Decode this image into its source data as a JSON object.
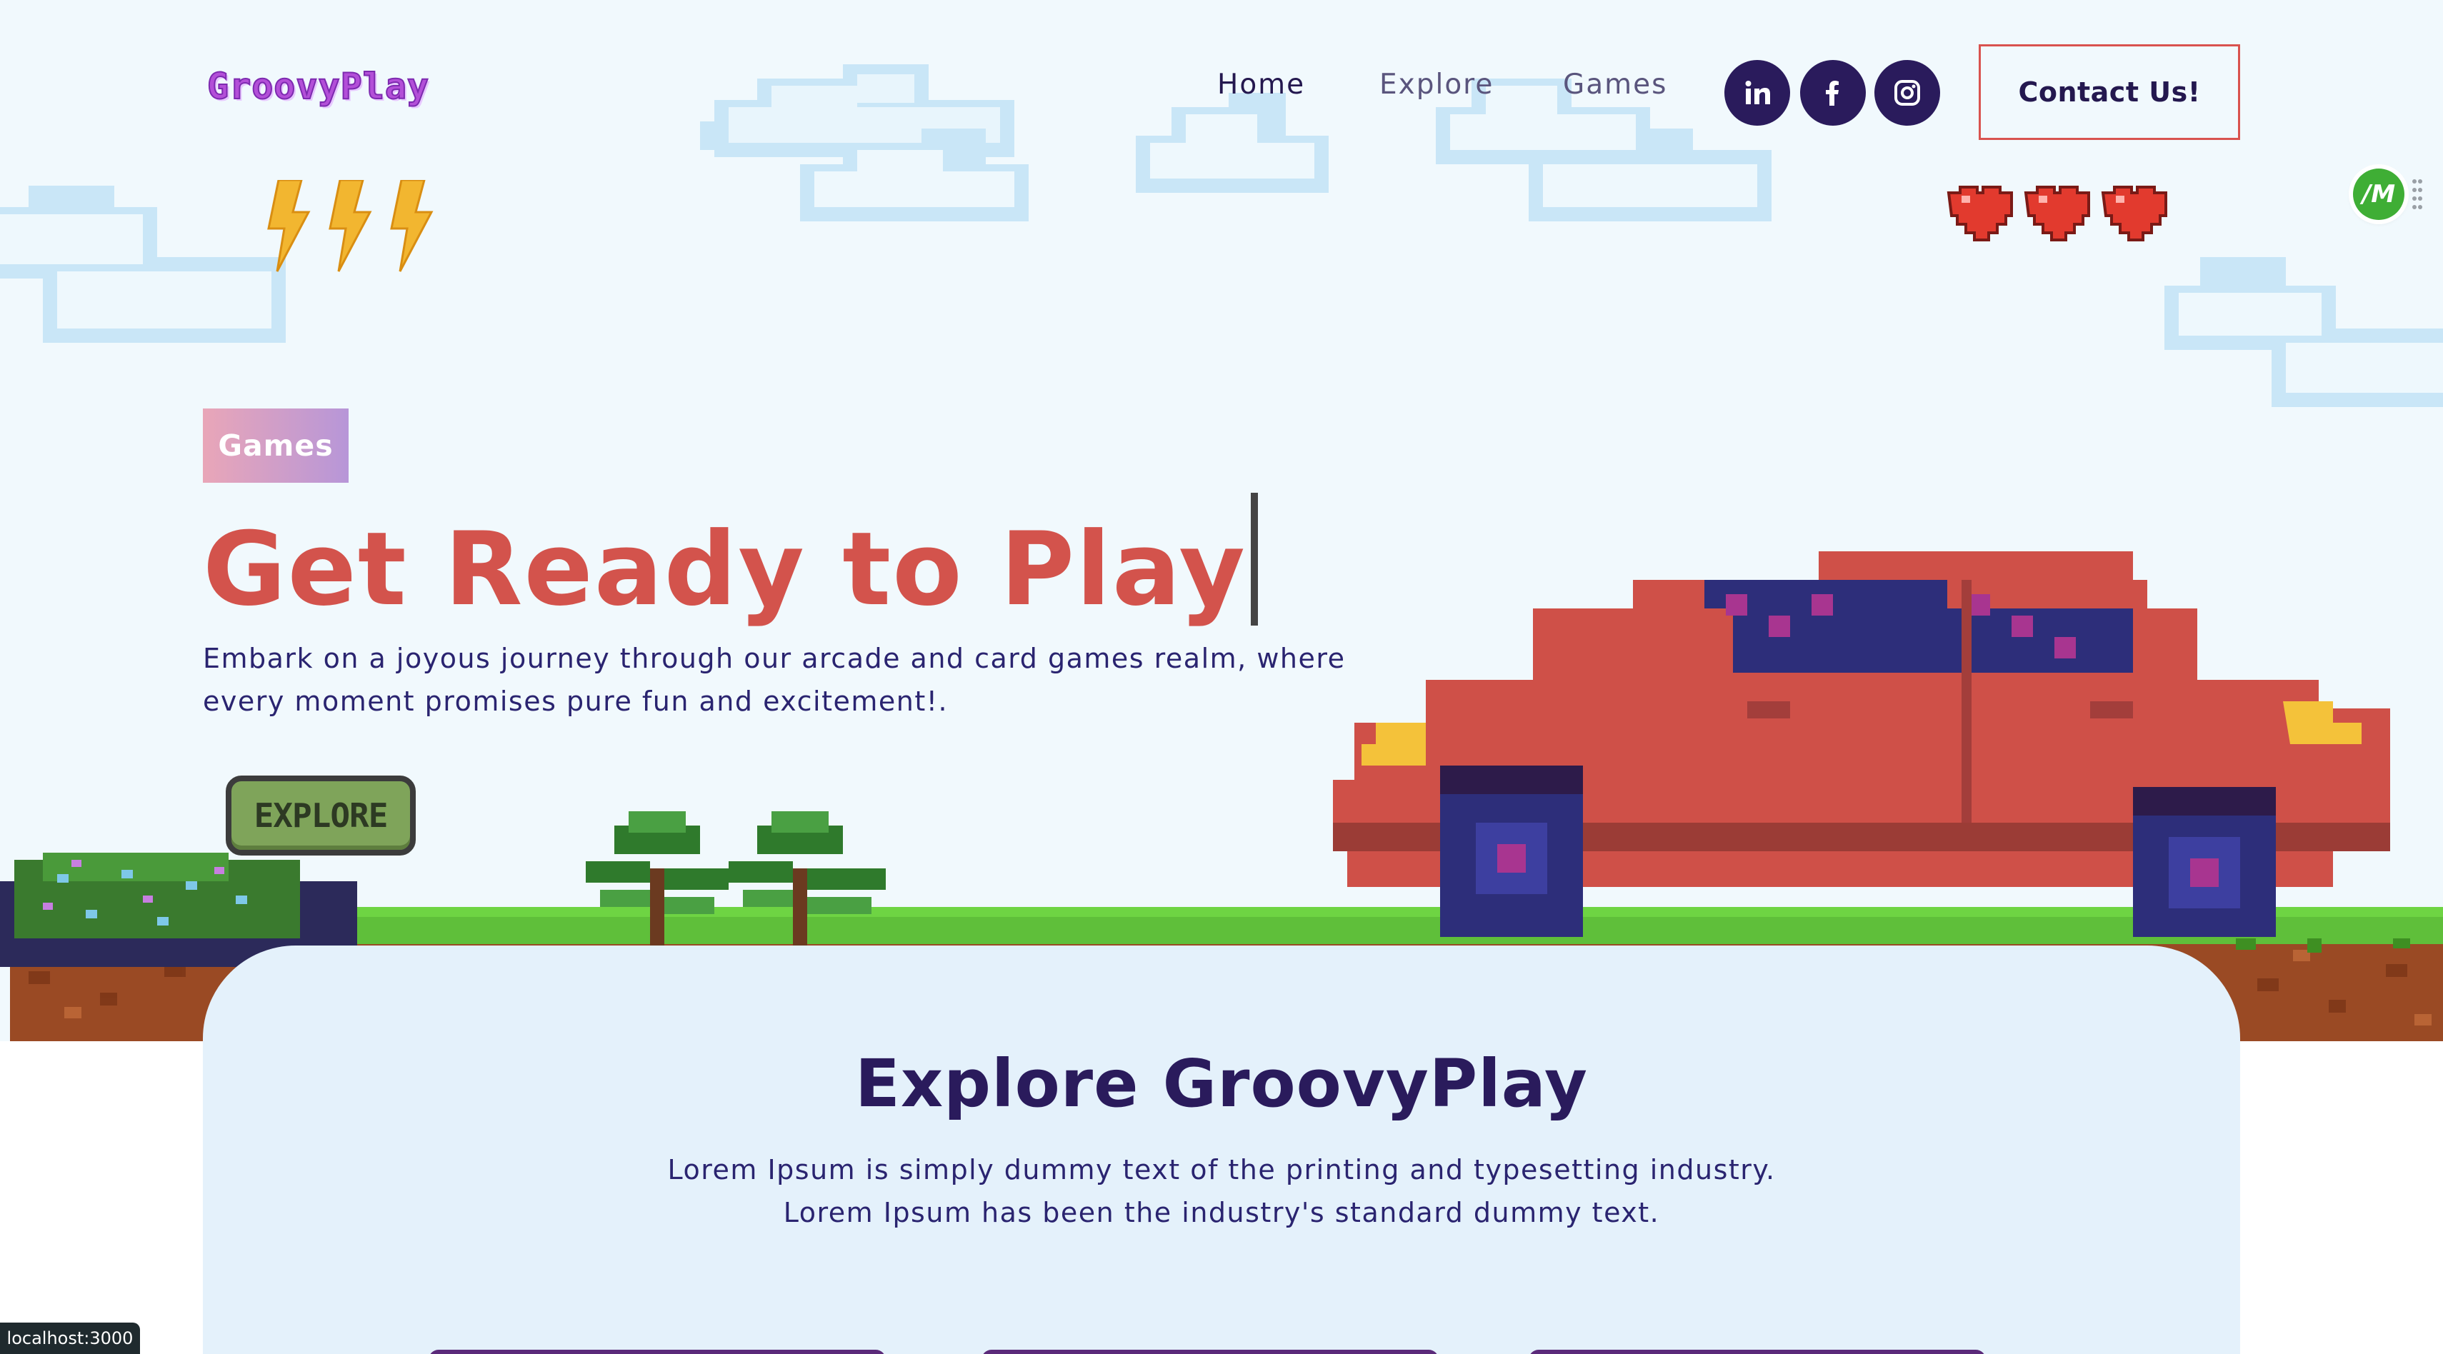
{
  "browser": {
    "status_url": "localhost:3000"
  },
  "header": {
    "logo_text": "GroovyPlay",
    "nav": [
      {
        "label": "Home",
        "active": true
      },
      {
        "label": "Explore",
        "active": false
      },
      {
        "label": "Games",
        "active": false
      }
    ],
    "social": [
      {
        "icon": "linkedin-icon",
        "label": "in"
      },
      {
        "icon": "facebook-icon"
      },
      {
        "icon": "instagram-icon"
      }
    ],
    "contact_label": "Contact Us!"
  },
  "extension": {
    "badge_label": "/M"
  },
  "hero": {
    "tag": "Games",
    "title": "Get Ready to Play",
    "description": "Embark on a joyous journey through our arcade and card games realm, where every moment promises pure fun and excitement!.",
    "explore_button": "EXPLORE",
    "lightning_count": 3,
    "hearts_count": 3
  },
  "explore_section": {
    "title": "Explore GroovyPlay",
    "description_line1": "Lorem Ipsum is simply dummy text of the printing and typesetting industry.",
    "description_line2": "Lorem Ipsum has been the industry's standard dummy text."
  },
  "colors": {
    "accent_red": "#d3534c",
    "navy": "#2a1b5c",
    "hero_bg": "#f1f9fd",
    "card_bg": "#e4f1fb"
  }
}
